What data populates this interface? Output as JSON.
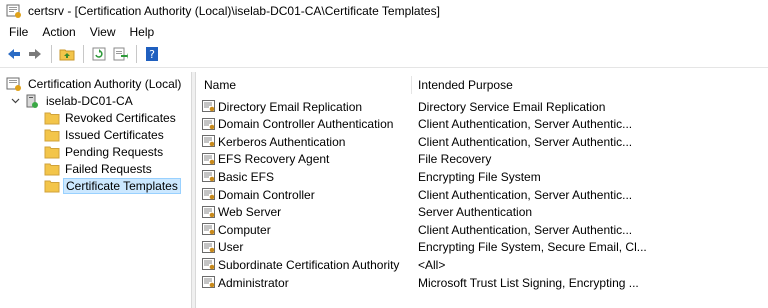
{
  "window": {
    "title": "certsrv - [Certification Authority (Local)\\iselab-DC01-CA\\Certificate Templates]"
  },
  "menu": [
    "File",
    "Action",
    "View",
    "Help"
  ],
  "toolbar": {
    "buttons": [
      "back-icon",
      "forward-icon",
      "up-folder-icon",
      "refresh-icon",
      "export-list-icon",
      "help-icon"
    ]
  },
  "tree": {
    "root": "Certification Authority (Local)",
    "ca": "iselab-DC01-CA",
    "children": [
      "Revoked Certificates",
      "Issued Certificates",
      "Pending Requests",
      "Failed Requests",
      "Certificate Templates"
    ],
    "selected": "Certificate Templates"
  },
  "list": {
    "columns": [
      "Name",
      "Intended Purpose"
    ],
    "rows": [
      {
        "name": "Directory Email Replication",
        "purpose": "Directory Service Email Replication"
      },
      {
        "name": "Domain Controller Authentication",
        "purpose": "Client Authentication, Server Authentic..."
      },
      {
        "name": "Kerberos Authentication",
        "purpose": "Client Authentication, Server Authentic..."
      },
      {
        "name": "EFS Recovery Agent",
        "purpose": "File Recovery"
      },
      {
        "name": "Basic EFS",
        "purpose": "Encrypting File System"
      },
      {
        "name": "Domain Controller",
        "purpose": "Client Authentication, Server Authentic..."
      },
      {
        "name": "Web Server",
        "purpose": "Server Authentication"
      },
      {
        "name": "Computer",
        "purpose": "Client Authentication, Server Authentic..."
      },
      {
        "name": "User",
        "purpose": "Encrypting File System, Secure Email, Cl..."
      },
      {
        "name": "Subordinate Certification Authority",
        "purpose": "<All>"
      },
      {
        "name": "Administrator",
        "purpose": "Microsoft Trust List Signing, Encrypting ..."
      }
    ]
  },
  "colors": {
    "selection_bg": "#cce8ff",
    "selection_border": "#99d1ff",
    "folder": "#f3c54a",
    "help_blue": "#1f5fbf"
  }
}
